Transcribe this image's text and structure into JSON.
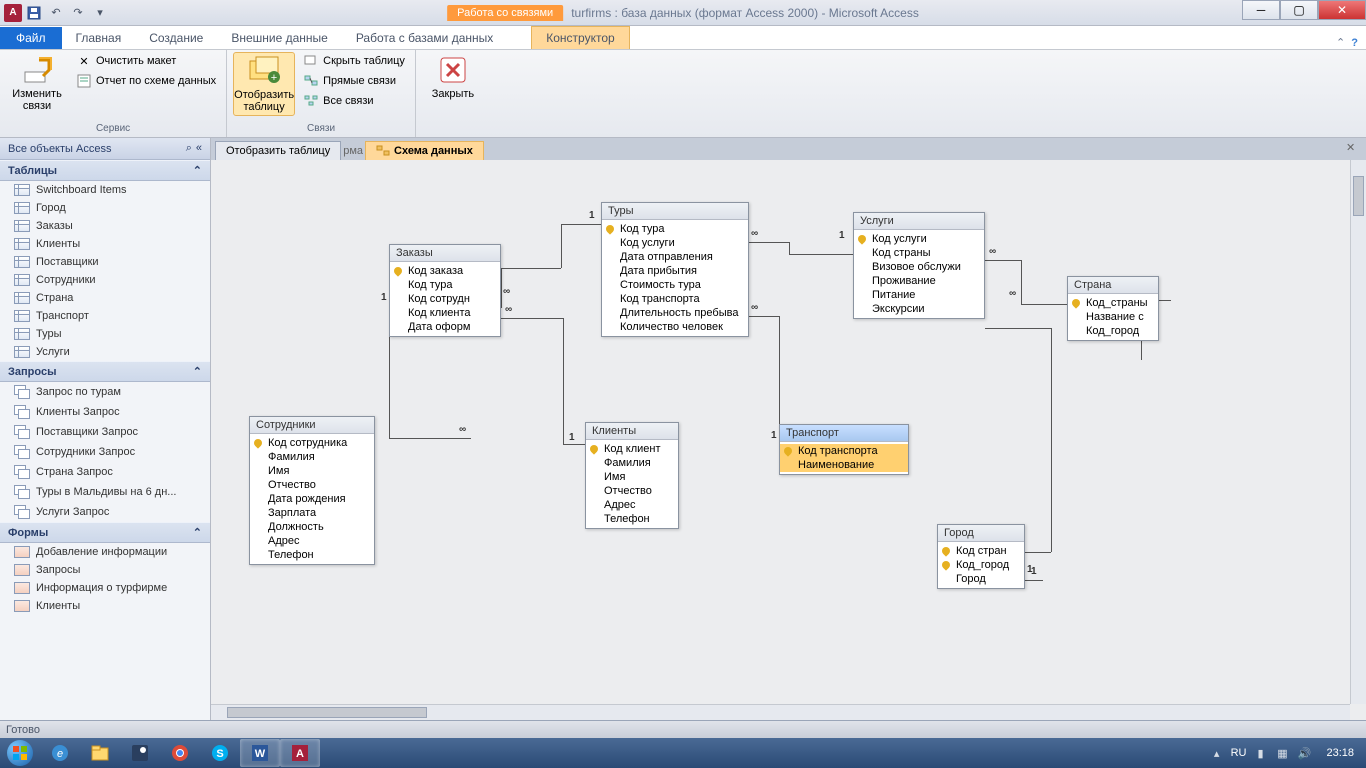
{
  "title": {
    "context_tab": "Работа со связями",
    "text": "turfirms : база данных (формат Access 2000)  -  Microsoft Access"
  },
  "ribbon_tabs": {
    "file": "Файл",
    "home": "Главная",
    "create": "Создание",
    "external": "Внешние данные",
    "dbtools": "Работа с базами данных",
    "designer": "Конструктор"
  },
  "ribbon": {
    "g1": {
      "edit_rel": "Изменить связи",
      "clear_layout": "Очистить макет",
      "rel_report": "Отчет по схеме данных",
      "label": "Сервис"
    },
    "g2": {
      "show_table": "Отобразить таблицу",
      "hide_table": "Скрыть таблицу",
      "direct_rel": "Прямые связи",
      "all_rel": "Все связи",
      "label": "Связи"
    },
    "g3": {
      "close": "Закрыть"
    }
  },
  "nav": {
    "header": "Все объекты Access",
    "sec_tables": "Таблицы",
    "tables": [
      "Switchboard Items",
      "Город",
      "Заказы",
      "Клиенты",
      "Поставщики",
      "Сотрудники",
      "Страна",
      "Транспорт",
      "Туры",
      "Услуги"
    ],
    "sec_queries": "Запросы",
    "queries": [
      "Запрос по турам",
      "Клиенты Запрос",
      "Поставщики Запрос",
      "Сотрудники Запрос",
      "Страна Запрос",
      "Туры в Мальдивы на 6 дн...",
      "Услуги Запрос"
    ],
    "sec_forms": "Формы",
    "forms": [
      "Добавление информации",
      "Запросы",
      "Информация о турфирме",
      "Клиенты"
    ]
  },
  "doc_tabs": {
    "t1": "Отобразить таблицу",
    "t1_suffix": "рма",
    "t2": "Схема данных"
  },
  "boxes": {
    "zakazy": {
      "title": "Заказы",
      "fields": [
        "Код заказа",
        "Код тура",
        "Код сотрудн",
        "Код клиента",
        "Дата оформ"
      ]
    },
    "tury": {
      "title": "Туры",
      "fields": [
        "Код тура",
        "Код услуги",
        "Дата отправления",
        "Дата прибытия",
        "Стоимость тура",
        "Код транспорта",
        "Длительность пребыва",
        "Количество человек"
      ]
    },
    "uslugi": {
      "title": "Услуги",
      "fields": [
        "Код услуги",
        "Код страны",
        "Визовое обслужи",
        "Проживание",
        "Питание",
        "Экскурсии"
      ]
    },
    "strana": {
      "title": "Страна",
      "fields": [
        "Код_страны",
        "Название с",
        "Код_город"
      ]
    },
    "sotrudniki": {
      "title": "Сотрудники",
      "fields": [
        "Код сотрудника",
        "Фамилия",
        "Имя",
        "Отчество",
        "Дата рождения",
        "Зарплата",
        "Должность",
        "Адрес",
        "Телефон"
      ]
    },
    "klienty": {
      "title": "Клиенты",
      "fields": [
        "Код клиент",
        "Фамилия",
        "Имя",
        "Отчество",
        "Адрес",
        "Телефон"
      ]
    },
    "transport": {
      "title": "Транспорт",
      "fields": [
        "Код транспорта",
        "Наименование"
      ]
    },
    "gorod": {
      "title": "Город",
      "fields": [
        "Код стран",
        "Код_город",
        "Город"
      ]
    }
  },
  "rel_labels": {
    "one": "1",
    "inf": "∞"
  },
  "status": "Готово",
  "tray": {
    "lang": "RU",
    "time": "23:18"
  }
}
